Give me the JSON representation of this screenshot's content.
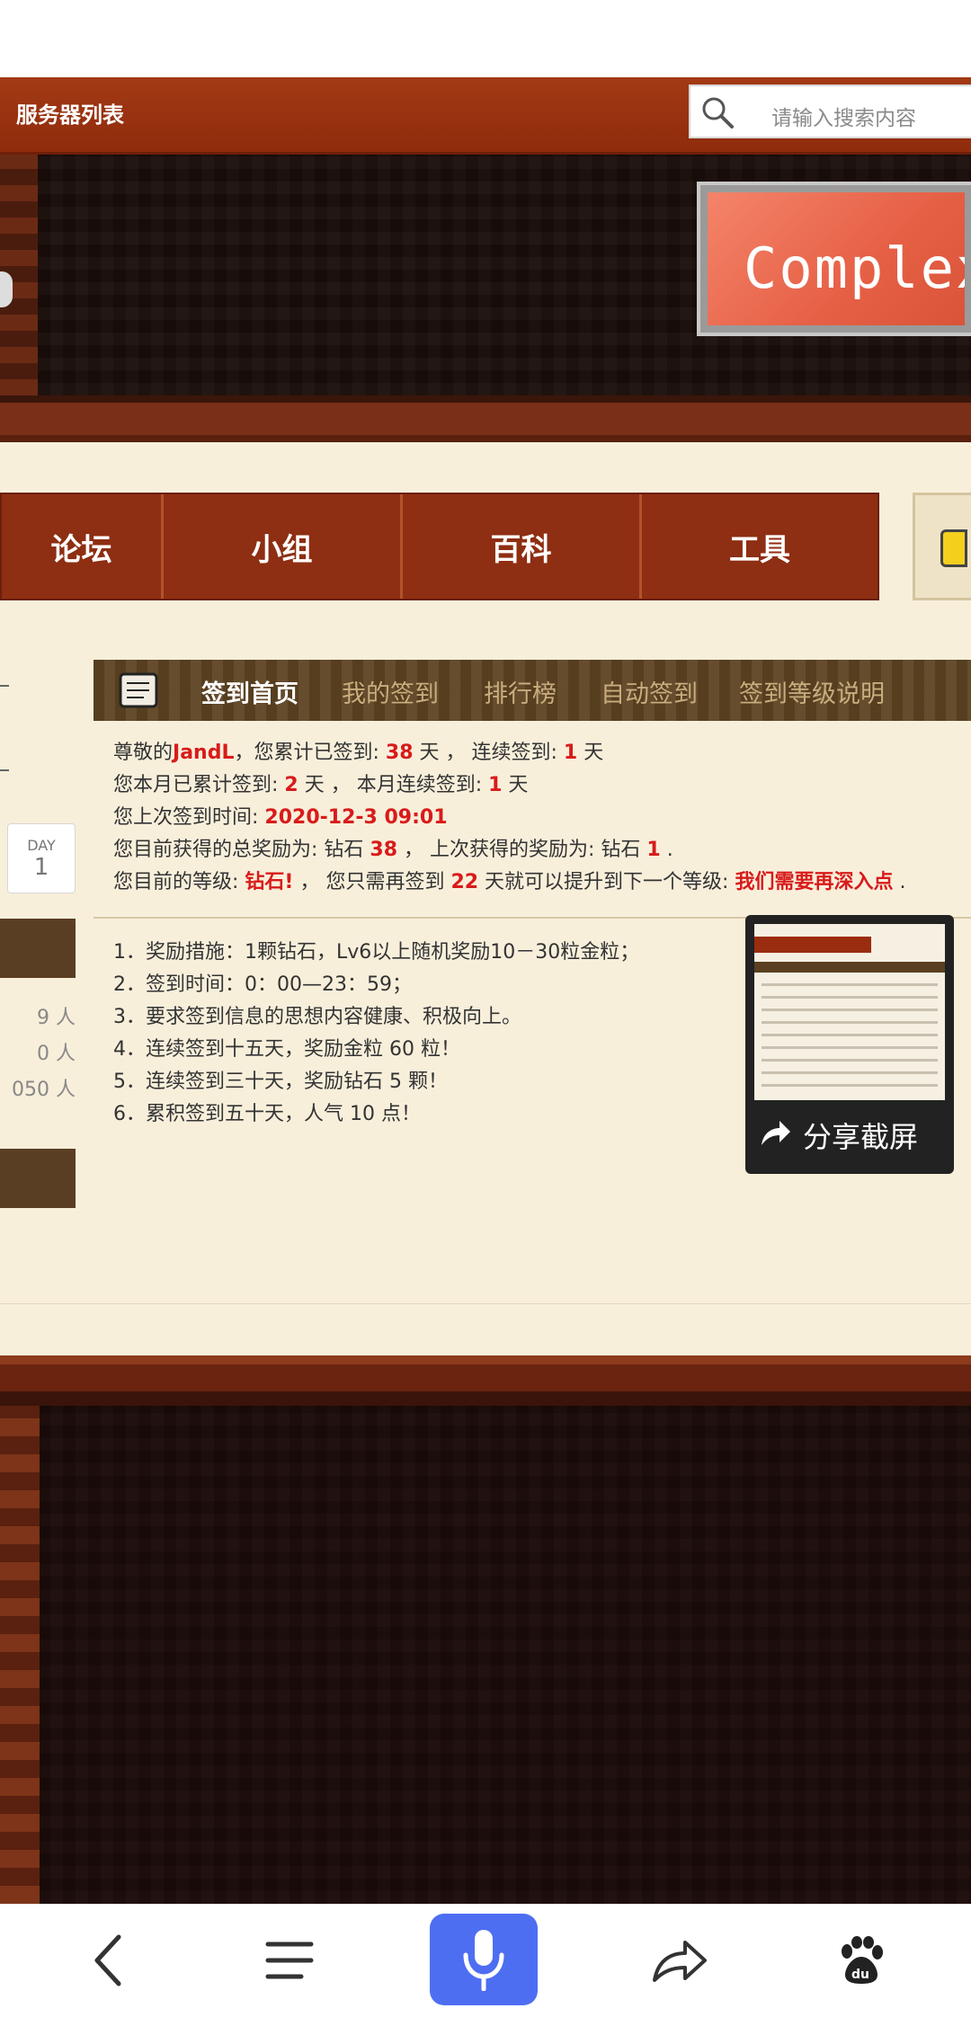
{
  "topbar": {
    "server_list": "服务器列表",
    "search_placeholder": "请输入搜索内容"
  },
  "banner": {
    "logo_text": "Complex"
  },
  "nav": {
    "items": [
      "论坛",
      "小组",
      "百科",
      "工具"
    ]
  },
  "left_panel": {
    "day_label": "DAY",
    "day_value": "1",
    "counts": [
      "9 人",
      "0 人",
      "050 人"
    ]
  },
  "signin_tabs": [
    "签到首页",
    "我的签到",
    "排行榜",
    "自动签到",
    "签到等级说明"
  ],
  "info": {
    "l1": {
      "a": "尊敬的",
      "user": "JandL",
      "b": "，您累计已签到: ",
      "total_days": "38",
      "c": " 天 ， 连续签到: ",
      "streak": "1",
      "d": " 天"
    },
    "l2": {
      "a": "您本月已累计签到: ",
      "month_days": "2",
      "b": " 天 ， 本月连续签到: ",
      "month_streak": "1",
      "c": " 天"
    },
    "l3": {
      "a": "您上次签到时间: ",
      "last_time": "2020-12-3 09:01"
    },
    "l4": {
      "a": "您目前获得的总奖励为: 钻石 ",
      "total_reward": "38",
      "b": " ， 上次获得的奖励为: 钻石 ",
      "last_reward": "1",
      "c": " ."
    },
    "l5": {
      "a": "您目前的等级: ",
      "level": "钻石!",
      "b": " ， 您只需再签到 ",
      "need_days": "22",
      "c": " 天就可以提升到下一个等级: ",
      "next_level": "我们需要再深入点",
      "d": " ."
    }
  },
  "rules": [
    "1．奖励措施：1颗钻石，Lv6以上随机奖励10－30粒金粒；",
    "2．签到时间：0：00—23：59；",
    "3．要求签到信息的思想内容健康、积极向上。",
    "4．连续签到十五天，奖励金粒 60 粒！",
    "5．连续签到三十天，奖励钻石 5 颗！",
    "6．累积签到五十天，人气 10 点！"
  ],
  "share": {
    "label": "分享截屏"
  },
  "colors": {
    "accent_red": "#d81b1b",
    "nav_brown": "#8e2e12",
    "baidu_blue": "#4e6ef2"
  },
  "bottom_bar": {
    "icons": [
      "back-icon",
      "menu-icon",
      "microphone-icon",
      "share-arrow-icon",
      "baidu-paw-icon"
    ]
  }
}
